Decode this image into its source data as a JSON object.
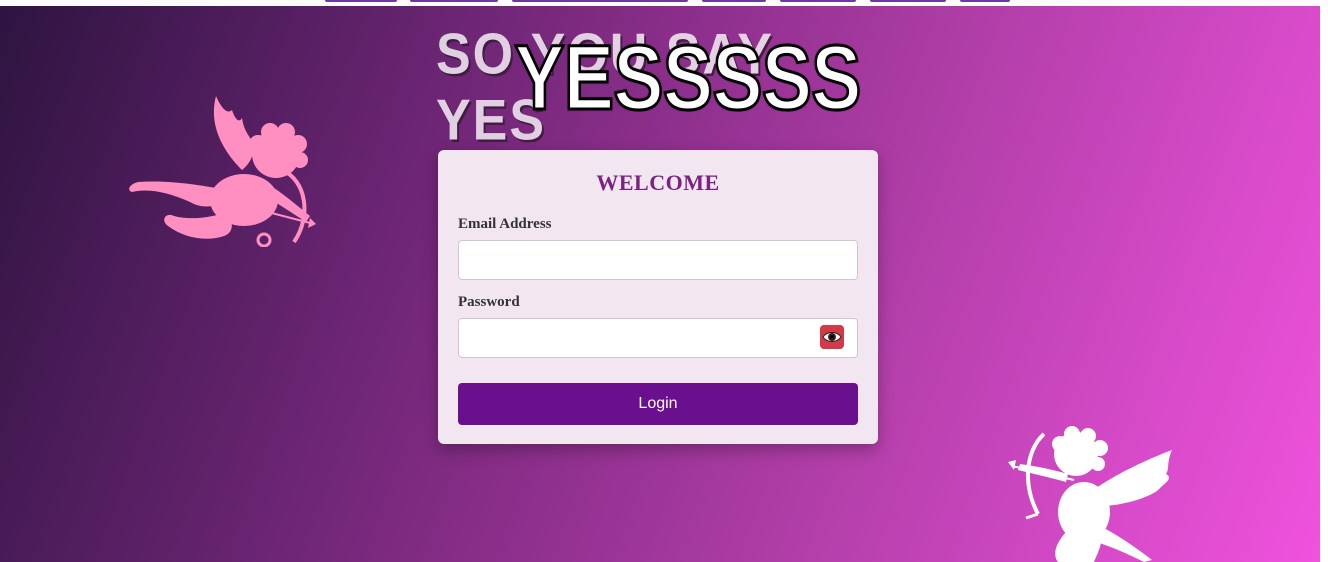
{
  "banner": {
    "back_text": "SO YOU SAY YES",
    "front_text": "YESSSSS"
  },
  "login": {
    "title": "WELCOME",
    "email_label": "Email Address",
    "email_value": "",
    "password_label": "Password",
    "password_value": "",
    "submit_label": "Login"
  },
  "icons": {
    "toggle_password": "eye-icon",
    "decor_left": "cupid-icon",
    "decor_right": "cupid-icon"
  },
  "colors": {
    "accent": "#6a0f8e",
    "title": "#7b2384",
    "eye_button": "#d33a48",
    "cupid_left": "#ff8fc0",
    "cupid_right": "#ffffff"
  }
}
